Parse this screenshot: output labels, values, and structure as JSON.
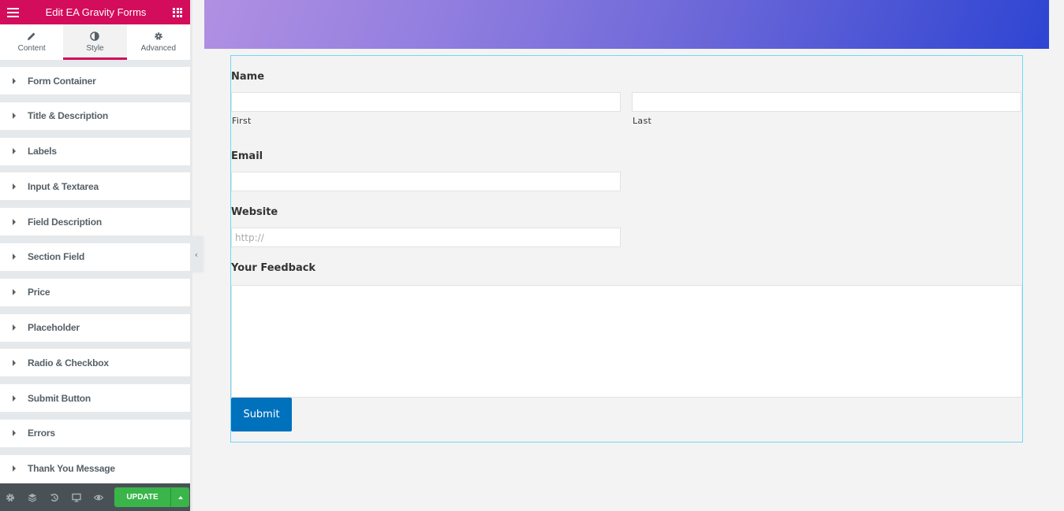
{
  "panel": {
    "title": "Edit EA Gravity Forms",
    "tabs": [
      {
        "label": "Content",
        "icon": "pencil-icon",
        "active": false
      },
      {
        "label": "Style",
        "icon": "half-circle-icon",
        "active": true
      },
      {
        "label": "Advanced",
        "icon": "gear-icon",
        "active": false
      }
    ],
    "sections": [
      {
        "label": "Form Container"
      },
      {
        "label": "Title & Description"
      },
      {
        "label": "Labels"
      },
      {
        "label": "Input & Textarea"
      },
      {
        "label": "Field Description"
      },
      {
        "label": "Section Field"
      },
      {
        "label": "Price"
      },
      {
        "label": "Placeholder"
      },
      {
        "label": "Radio & Checkbox"
      },
      {
        "label": "Submit Button"
      },
      {
        "label": "Errors"
      },
      {
        "label": "Thank You Message"
      }
    ],
    "footer": {
      "icons": [
        "settings-icon",
        "layers-icon",
        "history-icon",
        "responsive-icon",
        "preview-icon"
      ],
      "update_label": "UPDATE"
    }
  },
  "form": {
    "name_label": "Name",
    "first_sublabel": "First",
    "last_sublabel": "Last",
    "first_value": "",
    "last_value": "",
    "email_label": "Email",
    "email_value": "",
    "website_label": "Website",
    "website_placeholder": "http://",
    "website_value": "",
    "feedback_label": "Your Feedback",
    "feedback_value": "",
    "submit_label": "Submit"
  },
  "colors": {
    "brand": "#d30c5c",
    "update": "#39b54a",
    "submit": "#0071bc",
    "selection_outline": "#71d7f7"
  }
}
